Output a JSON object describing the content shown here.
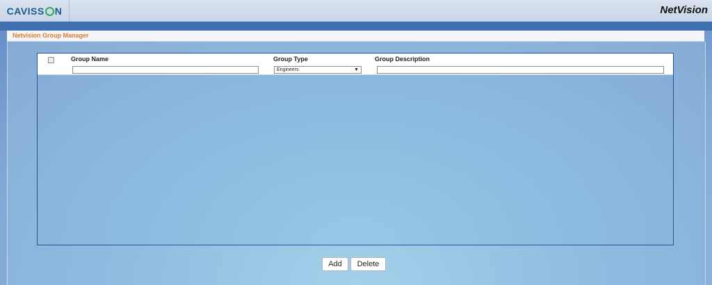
{
  "header": {
    "logo_left": "CAVISS",
    "logo_right": "N",
    "brand": "NetVision"
  },
  "panel": {
    "title": "Netvision Group Manager"
  },
  "grid": {
    "columns": {
      "group_name": "Group Name",
      "group_type": "Group Type",
      "group_description": "Group Description"
    },
    "filters": {
      "group_name_value": "",
      "group_type_selected": "Engineers",
      "group_description_value": ""
    },
    "rows": []
  },
  "actions": {
    "add_label": "Add",
    "delete_label": "Delete"
  }
}
